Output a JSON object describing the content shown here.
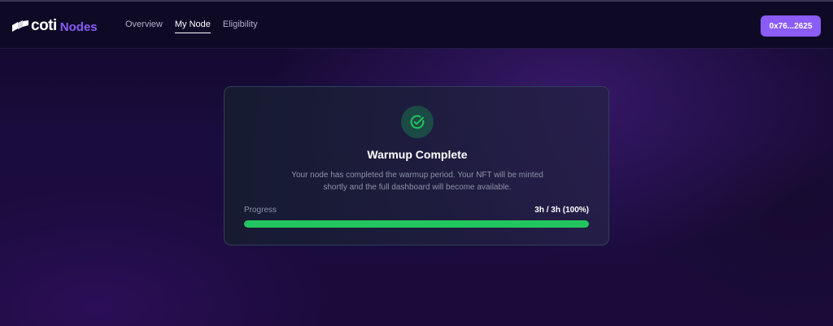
{
  "app": {
    "logo_coti": "coti",
    "logo_nodes": "Nodes"
  },
  "nav": {
    "items": [
      {
        "label": "Overview",
        "active": false
      },
      {
        "label": "My Node",
        "active": true
      },
      {
        "label": "Eligibility",
        "active": false
      }
    ]
  },
  "wallet": {
    "address_label": "0x76...2625"
  },
  "card": {
    "icon": "check-circle-icon",
    "title": "Warmup Complete",
    "description": "Your node has completed the warmup period. Your NFT will be minted shortly and the full dashboard will become available.",
    "progress_label": "Progress",
    "progress_value": "3h / 3h (100%)",
    "progress_fraction": 1.0
  },
  "colors": {
    "accent": "#8b5cf6",
    "success": "#22c55e",
    "success_bg": "#1c4a45"
  }
}
